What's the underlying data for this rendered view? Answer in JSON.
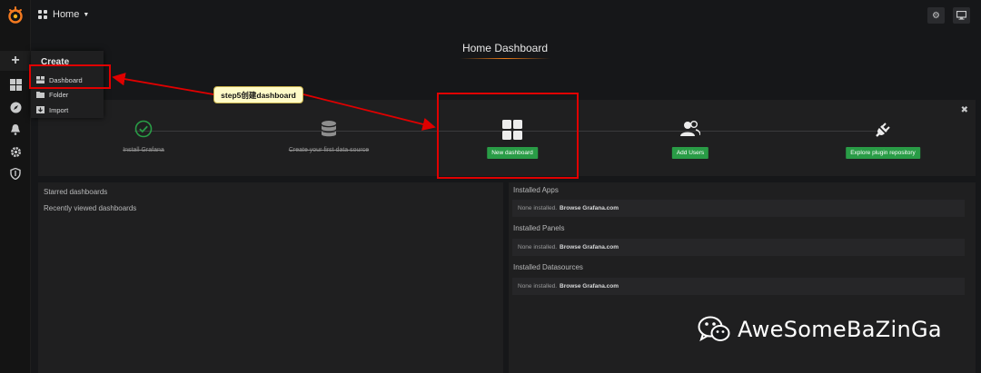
{
  "topbar": {
    "home_label": "Home"
  },
  "dashboard": {
    "title": "Home Dashboard"
  },
  "create_menu": {
    "title": "Create",
    "items": [
      {
        "label": "Dashboard"
      },
      {
        "label": "Folder"
      },
      {
        "label": "Import"
      }
    ]
  },
  "getting_started": {
    "steps": [
      {
        "label": "Install Grafana",
        "done": true
      },
      {
        "label": "Create your first data source",
        "done": true
      },
      {
        "label": "New dashboard",
        "done": false
      },
      {
        "label": "Add Users",
        "done": false
      },
      {
        "label": "Explore plugin repository",
        "done": false
      }
    ]
  },
  "left_panel": {
    "starred": "Starred dashboards",
    "recent": "Recently viewed dashboards"
  },
  "right_panel": {
    "sections": [
      {
        "title": "Installed Apps",
        "text": "None installed.",
        "link": "Browse Grafana.com"
      },
      {
        "title": "Installed Panels",
        "text": "None installed.",
        "link": "Browse Grafana.com"
      },
      {
        "title": "Installed Datasources",
        "text": "None installed.",
        "link": "Browse Grafana.com"
      }
    ]
  },
  "annotation": {
    "callout": "step5创建dashboard"
  },
  "watermark": {
    "text": "AweSomeBaZinGa"
  },
  "colors": {
    "accent": "#eb7b18",
    "success": "#299c46",
    "annotation": "#e00000"
  }
}
